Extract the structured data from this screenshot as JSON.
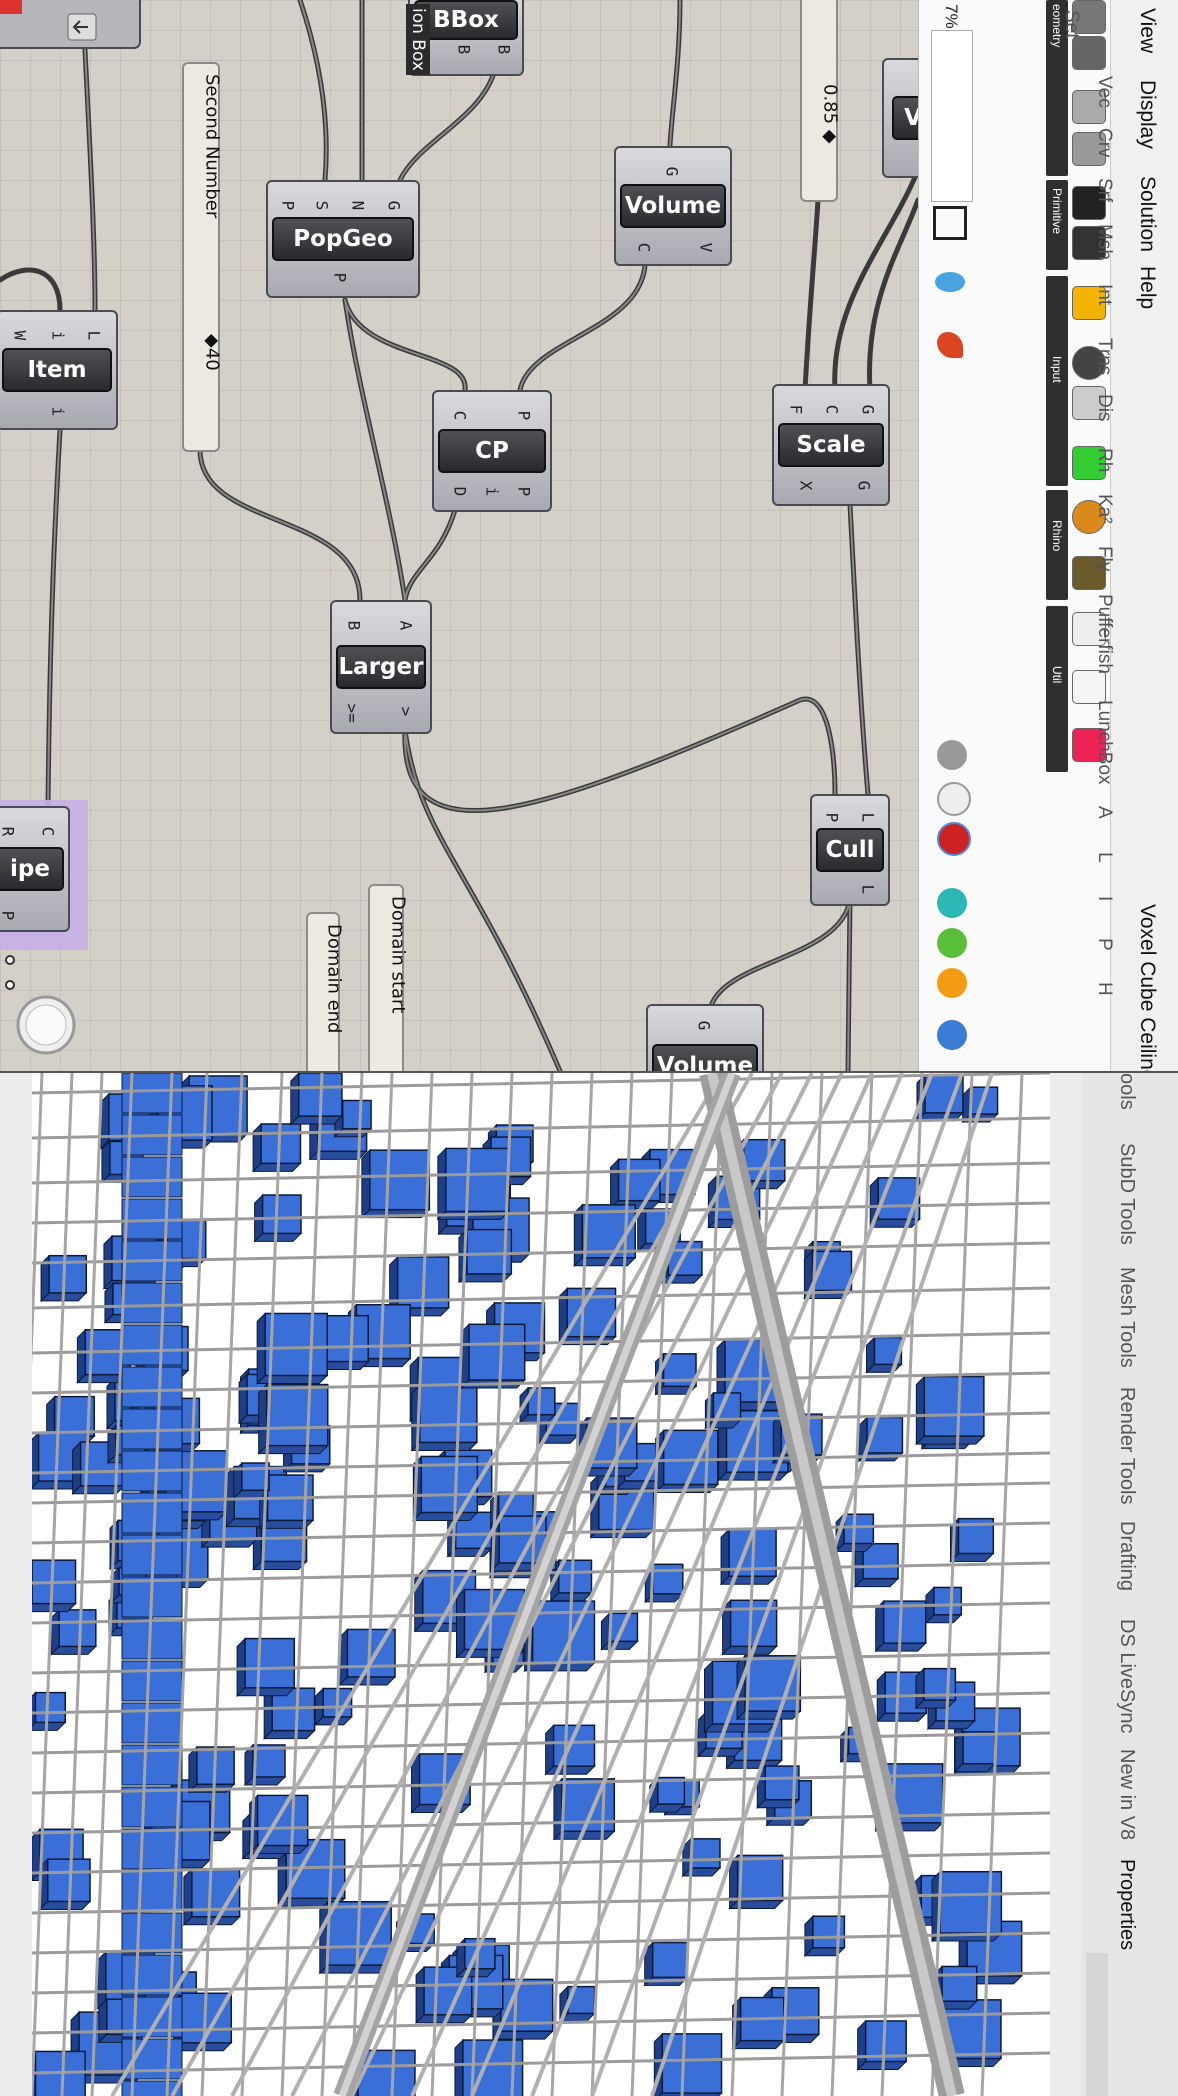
{
  "canvas": {
    "nodes": {
      "bbox": {
        "label": "BBox",
        "inputs": [],
        "outputs": [
          "B",
          "B"
        ]
      },
      "popgeo": {
        "label": "PopGeo",
        "inputs": [
          "P",
          "S",
          "N",
          "G"
        ],
        "outputs": [
          "P"
        ]
      },
      "volume_top": {
        "label": "Volume",
        "inputs": [
          "G"
        ],
        "outputs": [
          "C",
          "V"
        ]
      },
      "item": {
        "label": "Item",
        "inputs": [
          "W",
          "i",
          "L"
        ],
        "outputs": [
          "i"
        ]
      },
      "cp": {
        "label": "CP",
        "inputs": [
          "C",
          "P"
        ],
        "outputs": [
          "D",
          "i",
          "P"
        ]
      },
      "scale": {
        "label": "Scale",
        "inputs": [
          "F",
          "C",
          "G"
        ],
        "outputs": [
          "X",
          "G"
        ]
      },
      "larger": {
        "label": "Larger",
        "inputs": [
          "B",
          "A"
        ],
        "outputs": [
          ">=",
          ">"
        ]
      },
      "cull": {
        "label": "Cull",
        "inputs": [
          "P",
          "L"
        ],
        "outputs": [
          "L"
        ]
      },
      "pipe": {
        "label": "ipe",
        "inputs": [
          "R",
          "C"
        ],
        "outputs": [
          "P"
        ]
      },
      "volume_bottom": {
        "label": "Volume",
        "inputs": [
          "G"
        ],
        "outputs": []
      },
      "v_partial": {
        "label": "V"
      }
    },
    "panel_label_box": "ion Box",
    "sliders": {
      "second_number": {
        "name": "Second Number",
        "value": "◆40"
      },
      "factor": {
        "value": "0.85 ◆"
      }
    },
    "labels": {
      "domain_end": "Domain end",
      "domain_start": "Domain start"
    }
  },
  "ribbon": {
    "zoom": "7%",
    "menu": [
      "View",
      "Display",
      "Solution",
      "Help"
    ],
    "document_title": "Voxel Cube Ceiling",
    "tabs": [
      "Set",
      "Vec",
      "Crv",
      "Srf",
      "Msh",
      "Int",
      "Trns",
      "Dis",
      "Rh",
      "Ka²",
      "Fly",
      "Pufferfish",
      "LunchBox"
    ],
    "tabs_bottom": [
      "A",
      "L",
      "I",
      "P",
      "H"
    ],
    "groups": [
      "eometry",
      "Primitive",
      "Input",
      "Rhino",
      "Util"
    ],
    "colors": {
      "accent": "#3a6fd8"
    }
  },
  "rhino": {
    "side_tabs": [
      "ools",
      "SubD Tools",
      "Mesh Tools",
      "Render Tools",
      "Drafting",
      "DS LiveSync",
      "New in V8",
      "Properties"
    ]
  }
}
